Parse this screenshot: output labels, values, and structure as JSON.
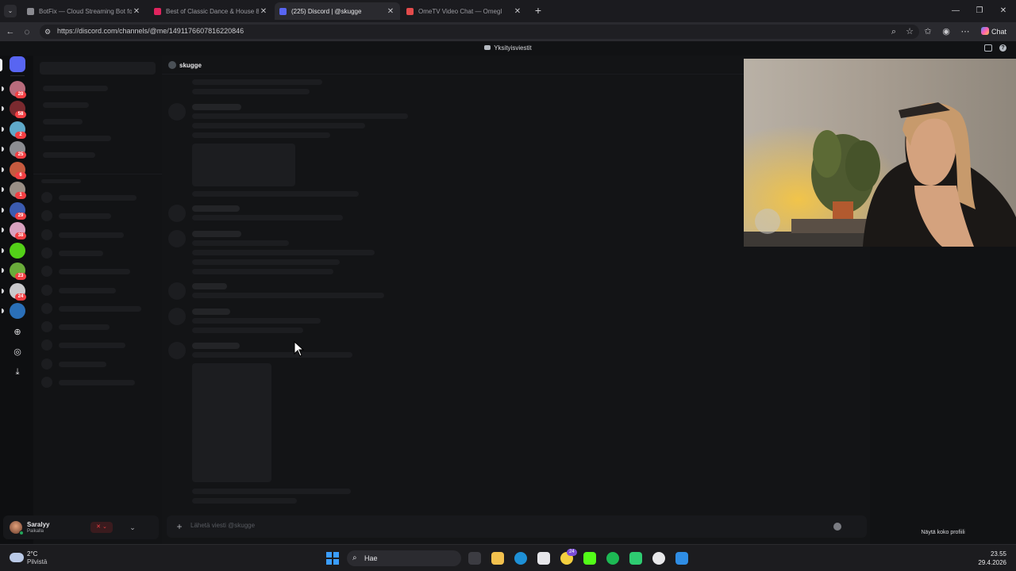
{
  "browser": {
    "tabs": [
      {
        "title": "BotFix — Cloud Streaming Bot for",
        "favicon_color": "#8a8a90"
      },
      {
        "title": "Best of Classic Dance & House 80",
        "favicon_color": "#e0245e"
      },
      {
        "title": "(225) Discord | @skugge",
        "favicon_color": "#5865f2"
      },
      {
        "title": "OmeTV Video Chat — Omegl",
        "favicon_color": "#e34b4b"
      }
    ],
    "url": "https://discord.com/channels/@me/1491176607816220846",
    "chat_button_label": "Chat"
  },
  "discord": {
    "window_title": "Yksityisviestit",
    "recipient": "skugge",
    "message_placeholder": "Lähetä viesti @skugge",
    "full_profile_label": "Näytä koko profiili",
    "servers": [
      {
        "badge": "20",
        "color": "#b86b7c"
      },
      {
        "badge": "58",
        "color": "#7a2a2f"
      },
      {
        "badge": "2",
        "color": "#5fa9c9"
      },
      {
        "badge": "25",
        "color": "#8c8d92"
      },
      {
        "badge": "6",
        "color": "#c65a3f"
      },
      {
        "badge": "1",
        "color": "#9a8f86"
      },
      {
        "badge": "29",
        "color": "#3b5bb0"
      },
      {
        "badge": "38",
        "color": "#d9a2c0"
      },
      {
        "badge": "",
        "color": "#53d018"
      },
      {
        "badge": "23",
        "color": "#6aab3a"
      },
      {
        "badge": "24",
        "color": "#c9c9cc"
      },
      {
        "badge": "",
        "color": "#2a6fb8"
      }
    ],
    "user": {
      "name": "Saralyy",
      "status": "Paikalla"
    }
  },
  "taskbar": {
    "weather_temp": "2°C",
    "weather_desc": "Pilvistä",
    "search_label": "Hae",
    "time": "23.55",
    "date": "29.4.2026",
    "notification_badge": "24"
  }
}
